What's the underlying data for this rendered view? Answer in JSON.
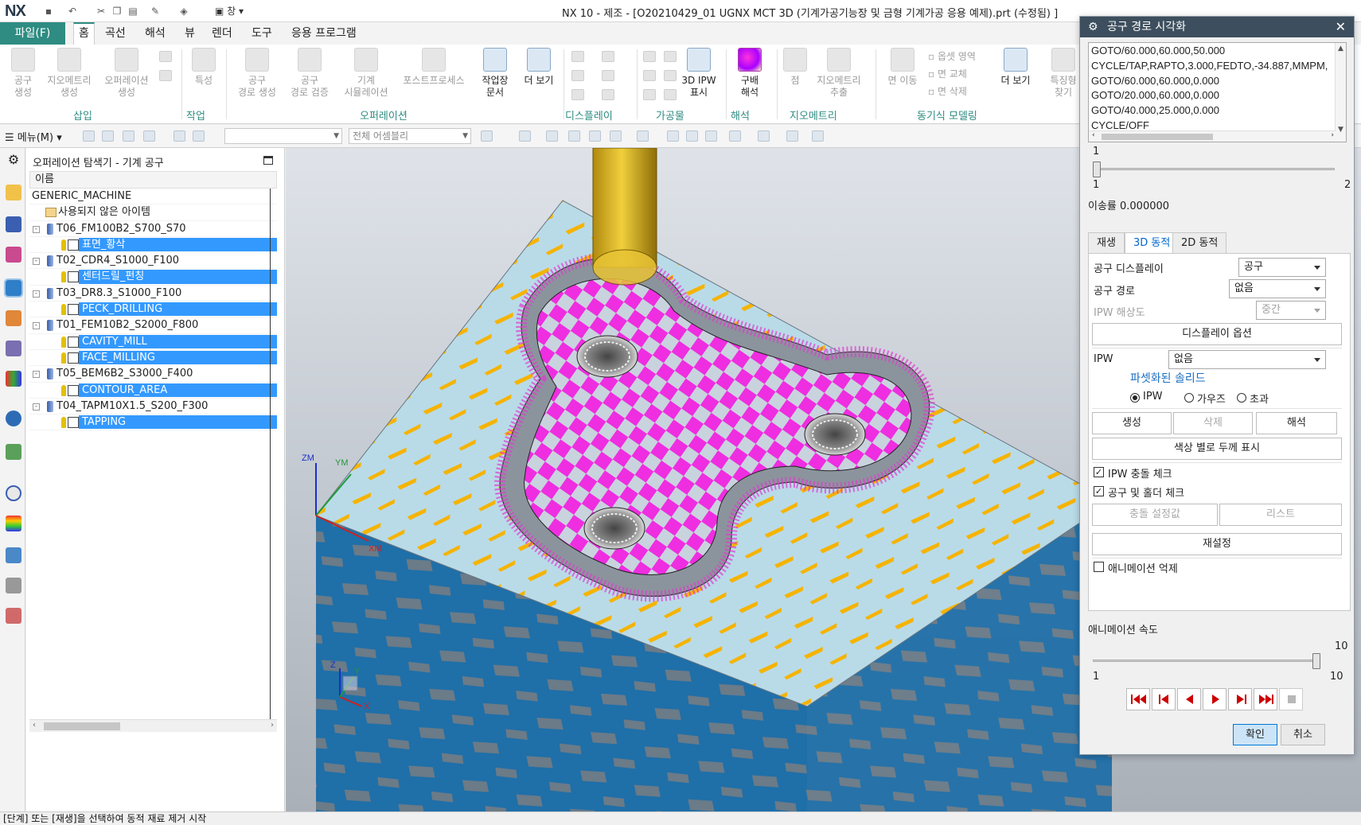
{
  "app": {
    "logo": "NX",
    "title": "NX 10 - 제조 - [O20210429_01 UGNX MCT 3D (기계가공기능장 및 금형 기계가공 응용 예제).prt (수정됨) ]",
    "window_menu": "창"
  },
  "ribbon_tabs": {
    "file": "파일(F)",
    "home": "홈",
    "curve": "곡선",
    "analysis": "해석",
    "view": "뷰",
    "render": "렌더",
    "tools": "도구",
    "application": "응용 프로그램"
  },
  "ribbon": {
    "create_tool": "공구\n생성",
    "create_geometry": "지오메트리\n생성",
    "create_operation": "오퍼레이션\n생성",
    "properties": "특성",
    "generate_path": "공구\n경로 생성",
    "verify_path": "공구\n경로 검증",
    "machine_sim": "기계\n시뮬레이션",
    "postprocess": "포스트프로세스",
    "shop_doc": "작업장\n문서",
    "more1": "더 보기",
    "ipw_display": "3D IPW\n표시",
    "gradient": "구배\n해석",
    "point": "점",
    "extract_geom": "지오메트리\n추출",
    "move_face": "면 이동",
    "offset_region": "옵셋 영역",
    "replace_face": "면 교체",
    "delete_face": "면 삭제",
    "more2": "더 보기",
    "feature_find": "특징형\n찾기",
    "groups": {
      "insert": "삽입",
      "work": "작업",
      "operation": "오퍼레이션",
      "display": "디스플레이",
      "machining": "가공물",
      "analysis": "해석",
      "geometry": "지오메트리",
      "sync": "동기식 모델링"
    }
  },
  "toolbar": {
    "menu": "메뉴(M)",
    "filter_placeholder": "",
    "assembly": "전체 어셈블리"
  },
  "navigator": {
    "title": "오퍼레이션 탐색기 - 기계 공구",
    "column": "이름",
    "rows": [
      {
        "label": "GENERIC_MACHINE",
        "kind": "root"
      },
      {
        "label": "사용되지 않은 아이템",
        "kind": "folder"
      },
      {
        "label": "T06_FM100B2_S700_S70",
        "kind": "tool"
      },
      {
        "label": "표면_황삭",
        "kind": "op"
      },
      {
        "label": "T02_CDR4_S1000_F100",
        "kind": "tool"
      },
      {
        "label": "센터드릴_펀칭",
        "kind": "op"
      },
      {
        "label": "T03_DR8.3_S1000_F100",
        "kind": "tool"
      },
      {
        "label": "PECK_DRILLING",
        "kind": "op"
      },
      {
        "label": "T01_FEM10B2_S2000_F800",
        "kind": "tool"
      },
      {
        "label": "CAVITY_MILL",
        "kind": "op"
      },
      {
        "label": "FACE_MILLING",
        "kind": "op"
      },
      {
        "label": "T05_BEM6B2_S3000_F400",
        "kind": "tool"
      },
      {
        "label": "CONTOUR_AREA",
        "kind": "op"
      },
      {
        "label": "T04_TAPM10X1.5_S200_F300",
        "kind": "tool"
      },
      {
        "label": "TAPPING",
        "kind": "op"
      }
    ]
  },
  "viewport": {
    "zm": "ZM",
    "ym": "YM",
    "xm": "XM",
    "z": "Z",
    "y": "Y",
    "x": "X"
  },
  "status": "[단계] 또는 [재생]을 선택하여 동적 재료 제거 시작",
  "dialog": {
    "title": "공구 경로 시각화",
    "path_lines": [
      "GOTO/60.000,60.000,50.000",
      "CYCLE/TAP,RAPTO,3.000,FEDTO,-34.887,MMPM,",
      "GOTO/60.000,60.000,0.000",
      "GOTO/20.000,60.000,0.000",
      "GOTO/40.000,25.000,0.000",
      "CYCLE/OFF"
    ],
    "step_value": "1",
    "step_min": "1",
    "step_max": "2",
    "step_position": 0.0,
    "travel_rate": "이송률 0.000000",
    "tabs": {
      "replay": "재생",
      "dynamic3d": "3D 동적",
      "dynamic2d": "2D 동적"
    },
    "tool_display_label": "공구 디스플레이",
    "tool_display_value": "공구",
    "tool_path_label": "공구 경로",
    "tool_path_value": "없음",
    "ipw_res_label": "IPW 해상도",
    "ipw_res_value": "중간",
    "display_options": "디스플레이 옵션",
    "ipw_label": "IPW",
    "ipw_value": "없음",
    "faceted_solid": "파셋화된 솔리드",
    "radio_ipw": "IPW",
    "radio_gouge": "가우즈",
    "radio_excess": "초과",
    "create": "생성",
    "delete": "삭제",
    "analyze": "해석",
    "color_thickness": "색상 별로 두께 표시",
    "ipw_collision": "IPW 충돌 체크",
    "tool_holder_check": "공구 및 홀더 체크",
    "collision_settings": "충돌 설정값",
    "list": "리스트",
    "reset": "재설정",
    "suppress_anim": "애니메이션 억제",
    "anim_speed": "애니메이션 속도",
    "speed_value": "10",
    "speed_min": "1",
    "speed_max": "10",
    "speed_position": 1.0,
    "ok": "확인",
    "cancel": "취소"
  }
}
